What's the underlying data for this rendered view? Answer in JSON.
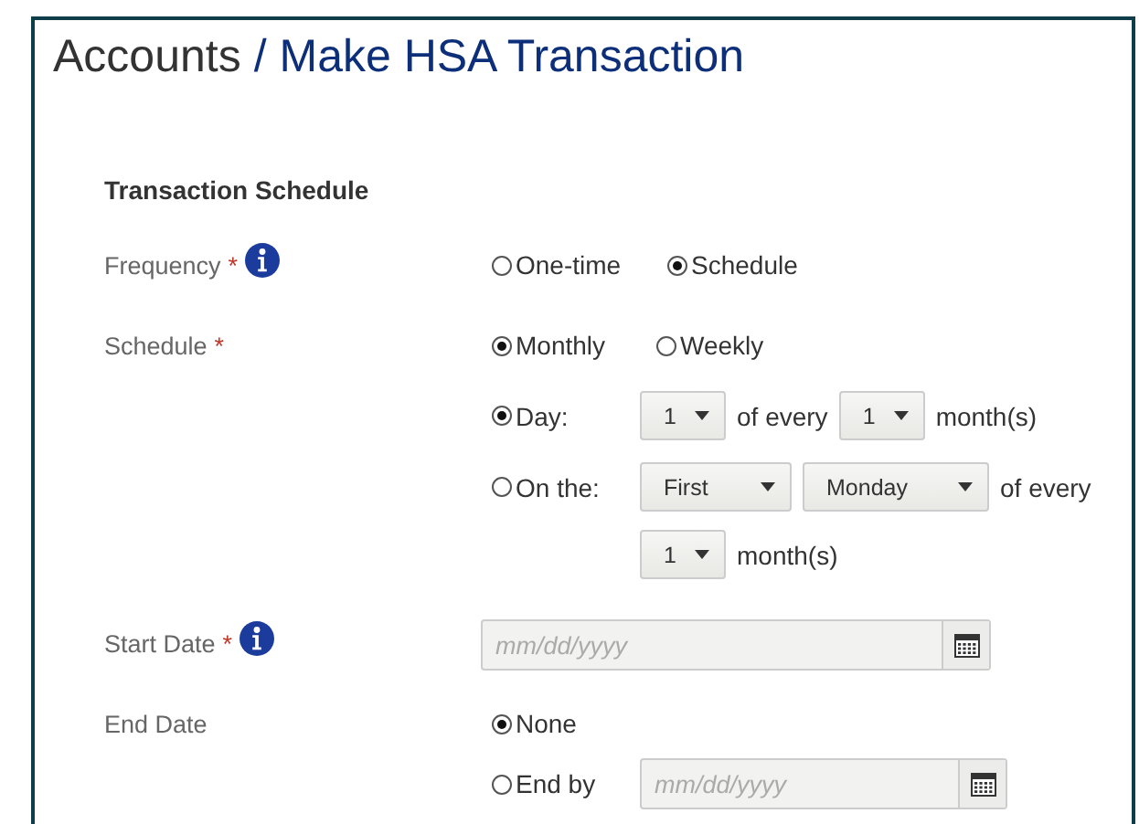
{
  "breadcrumb": {
    "parent": "Accounts",
    "separator": "/",
    "current": "Make HSA Transaction"
  },
  "section_title": "Transaction Schedule",
  "frequency": {
    "label": "Frequency",
    "required_mark": "*",
    "info": true,
    "options": [
      {
        "label": "One-time",
        "selected": false
      },
      {
        "label": "Schedule",
        "selected": true
      }
    ]
  },
  "schedule": {
    "label": "Schedule",
    "required_mark": "*",
    "options": [
      {
        "label": "Monthly",
        "selected": true
      },
      {
        "label": "Weekly",
        "selected": false
      }
    ],
    "day_option": {
      "label": "Day:",
      "selected": true,
      "day": "1",
      "of_every": "of every",
      "months": "1",
      "unit": "month(s)"
    },
    "on_the_option": {
      "label": "On the:",
      "selected": false,
      "ordinal": "First",
      "weekday": "Monday",
      "of_every": "of every",
      "months": "1",
      "unit": "month(s)"
    }
  },
  "start_date": {
    "label": "Start Date",
    "required_mark": "*",
    "info": true,
    "placeholder": "mm/dd/yyyy"
  },
  "end_date": {
    "label": "End Date",
    "options": [
      {
        "label": "None",
        "selected": true
      },
      {
        "label": "End by",
        "selected": false,
        "placeholder": "mm/dd/yyyy"
      }
    ]
  }
}
